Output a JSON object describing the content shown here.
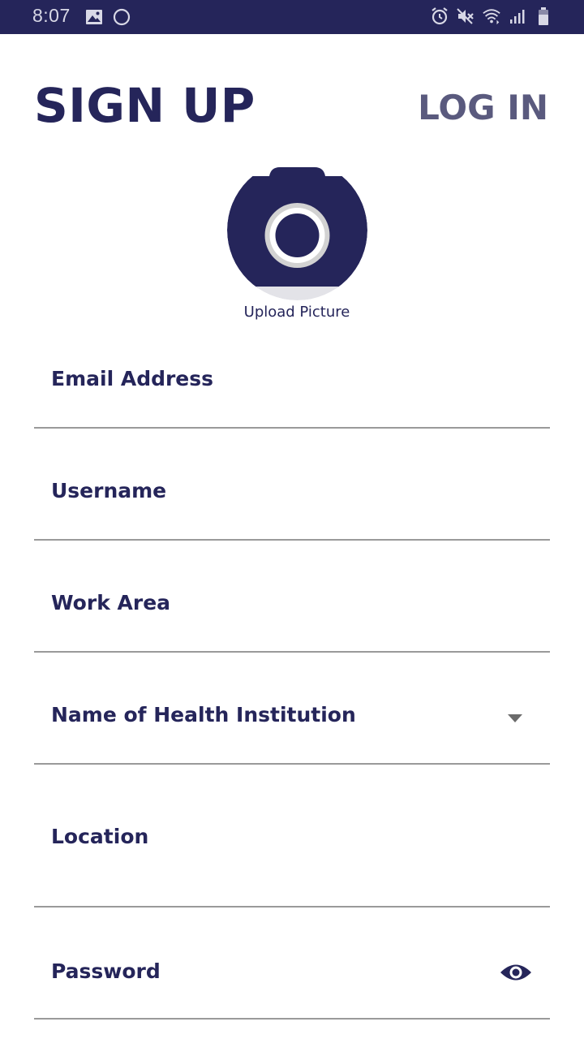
{
  "status_bar": {
    "time": "8:07",
    "left_icons": [
      "image-icon",
      "circle-icon"
    ],
    "right_icons": [
      "alarm-icon",
      "mute-icon",
      "wifi-icon",
      "signal-icon",
      "battery-icon"
    ]
  },
  "header": {
    "signup_label": "SIGN UP",
    "login_label": "LOG IN"
  },
  "avatar": {
    "icon": "camera-icon",
    "caption": "Upload Picture"
  },
  "form": {
    "email": {
      "label": "Email Address",
      "value": ""
    },
    "username": {
      "label": "Username",
      "value": ""
    },
    "work_area": {
      "label": "Work Area",
      "value": ""
    },
    "health_institution": {
      "label": "Name of Health Institution",
      "value": "",
      "icon": "dropdown-arrow-icon"
    },
    "location": {
      "label": "Location",
      "value": ""
    },
    "password": {
      "label": "Password",
      "value": "",
      "icon": "eye-icon"
    }
  },
  "colors": {
    "primary": "#25255a",
    "secondary_text": "#5a5a7e",
    "divider": "#9a9a9a",
    "background": "#ffffff"
  }
}
